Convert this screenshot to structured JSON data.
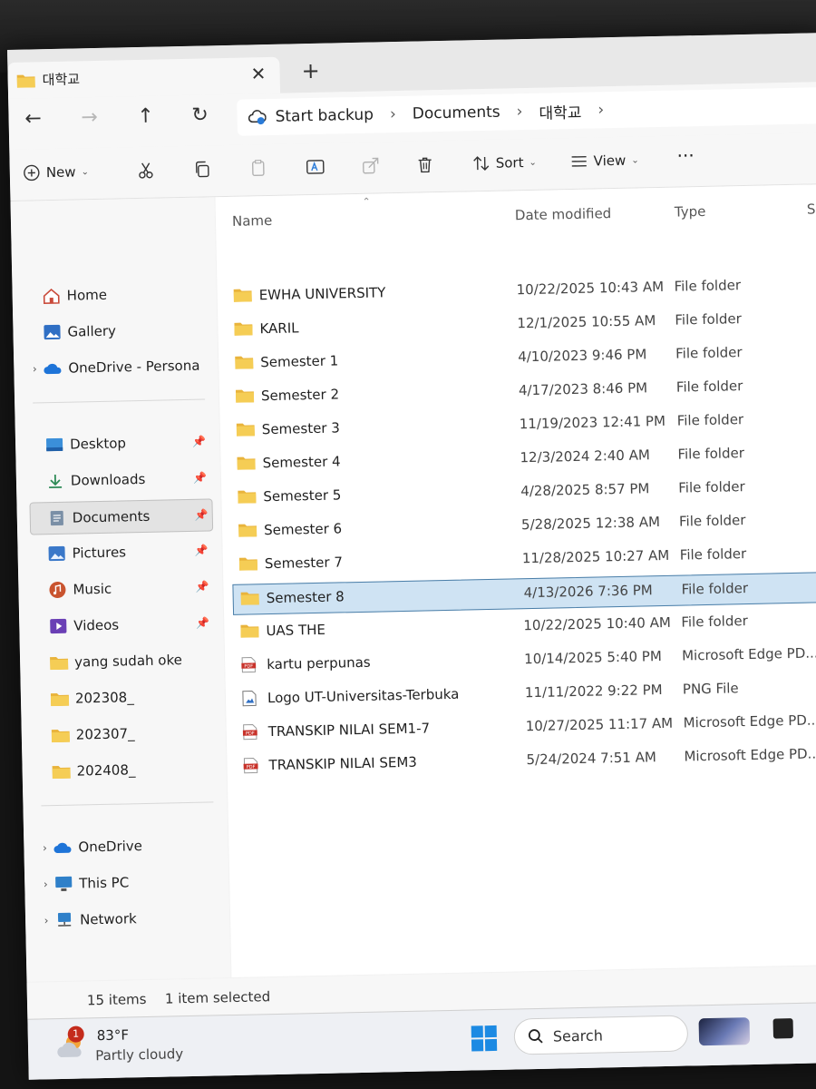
{
  "tab": {
    "title": "대학교",
    "close": "✕",
    "add": "+"
  },
  "nav": {
    "back": "←",
    "forward": "→",
    "up": "↑",
    "refresh": "↻"
  },
  "breadcrumb": {
    "items": [
      "Start backup",
      "Documents",
      "대학교"
    ],
    "sep": "›"
  },
  "commands": {
    "new": "New",
    "sort": "Sort",
    "view": "View",
    "more": "···"
  },
  "sidebar": {
    "quick": [
      {
        "label": "Home",
        "icon": "home-icon"
      },
      {
        "label": "Gallery",
        "icon": "gallery-icon"
      },
      {
        "label": "OneDrive - Persona",
        "icon": "onedrive-icon"
      }
    ],
    "pinned": [
      {
        "label": "Desktop",
        "icon": "desktop-icon",
        "pinned": true
      },
      {
        "label": "Downloads",
        "icon": "download-icon",
        "pinned": true
      },
      {
        "label": "Documents",
        "icon": "documents-icon",
        "pinned": true,
        "selected": true
      },
      {
        "label": "Pictures",
        "icon": "pictures-icon",
        "pinned": true
      },
      {
        "label": "Music",
        "icon": "music-icon",
        "pinned": true
      },
      {
        "label": "Videos",
        "icon": "videos-icon",
        "pinned": true
      },
      {
        "label": "yang sudah oke",
        "icon": "folder-icon"
      },
      {
        "label": "202308_",
        "icon": "folder-icon"
      },
      {
        "label": "202307_",
        "icon": "folder-icon"
      },
      {
        "label": "202408_",
        "icon": "folder-icon"
      }
    ],
    "locations": [
      {
        "label": "OneDrive",
        "icon": "onedrive-icon"
      },
      {
        "label": "This PC",
        "icon": "pc-icon"
      },
      {
        "label": "Network",
        "icon": "network-icon"
      }
    ]
  },
  "columns": {
    "name": "Name",
    "date": "Date modified",
    "type": "Type",
    "size": "Size"
  },
  "files": [
    {
      "name": "EWHA UNIVERSITY",
      "date": "10/22/2025 10:43 AM",
      "type": "File folder",
      "icon": "folder-icon"
    },
    {
      "name": "KARIL",
      "date": "12/1/2025 10:55 AM",
      "type": "File folder",
      "icon": "folder-icon"
    },
    {
      "name": "Semester 1",
      "date": "4/10/2023 9:46 PM",
      "type": "File folder",
      "icon": "folder-icon"
    },
    {
      "name": "Semester 2",
      "date": "4/17/2023 8:46 PM",
      "type": "File folder",
      "icon": "folder-icon"
    },
    {
      "name": "Semester 3",
      "date": "11/19/2023 12:41 PM",
      "type": "File folder",
      "icon": "folder-icon"
    },
    {
      "name": "Semester 4",
      "date": "12/3/2024 2:40 AM",
      "type": "File folder",
      "icon": "folder-icon"
    },
    {
      "name": "Semester 5",
      "date": "4/28/2025 8:57 PM",
      "type": "File folder",
      "icon": "folder-icon"
    },
    {
      "name": "Semester 6",
      "date": "5/28/2025 12:38 AM",
      "type": "File folder",
      "icon": "folder-icon"
    },
    {
      "name": "Semester 7",
      "date": "11/28/2025 10:27 AM",
      "type": "File folder",
      "icon": "folder-icon"
    },
    {
      "name": "Semester 8",
      "date": "4/13/2026 7:36 PM",
      "type": "File folder",
      "icon": "folder-icon",
      "selected": true
    },
    {
      "name": "UAS THE",
      "date": "10/22/2025 10:40 AM",
      "type": "File folder",
      "icon": "folder-icon"
    },
    {
      "name": "kartu perpunas",
      "date": "10/14/2025 5:40 PM",
      "type": "Microsoft Edge PD...",
      "icon": "pdf-icon"
    },
    {
      "name": "Logo UT-Universitas-Terbuka",
      "date": "11/11/2022 9:22 PM",
      "type": "PNG File",
      "icon": "image-file-icon"
    },
    {
      "name": "TRANSKIP NILAI SEM1-7",
      "date": "10/27/2025 11:17 AM",
      "type": "Microsoft Edge PD...",
      "icon": "pdf-icon"
    },
    {
      "name": "TRANSKIP NILAI SEM3",
      "date": "5/24/2024 7:51 AM",
      "type": "Microsoft Edge PD...",
      "icon": "pdf-icon"
    }
  ],
  "status": {
    "count": "15 items",
    "selected": "1 item selected"
  },
  "taskbar": {
    "weather_badge": "1",
    "temperature": "83°F",
    "condition": "Partly cloudy",
    "search_label": "Search"
  },
  "colors": {
    "folder": "#f2c14e",
    "selection": "#cfe3f3",
    "accent": "#0078d4"
  }
}
